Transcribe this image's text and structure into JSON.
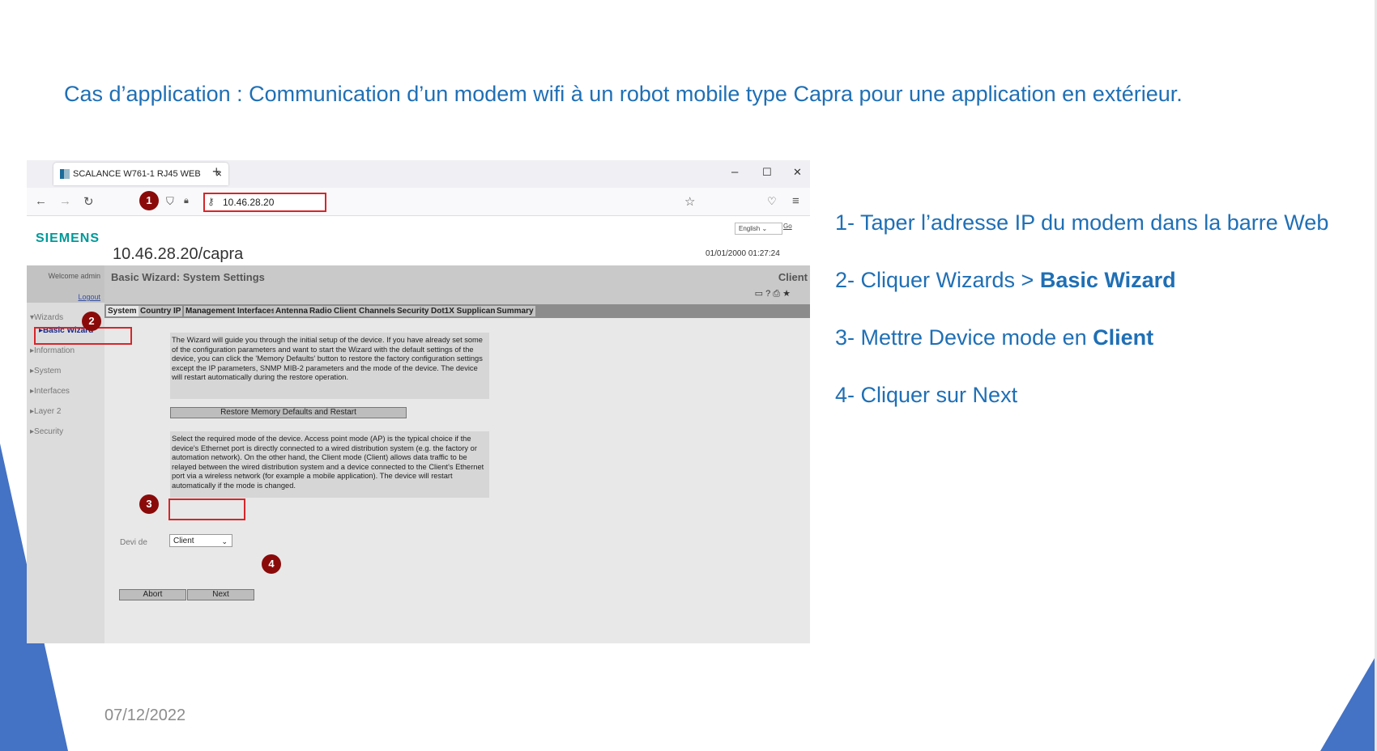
{
  "slide": {
    "title": "Cas d’application : Communication d’un modem wifi à un robot mobile type Capra pour une application en extérieur.",
    "steps": [
      {
        "text": "1- Taper l’adresse IP du modem dans la barre Web",
        "bold": ""
      },
      {
        "text": "2- Cliquer Wizards > ",
        "bold": "Basic Wizard"
      },
      {
        "text": "3- Mettre Device mode en ",
        "bold": "Client"
      },
      {
        "text": "4- Cliquer sur Next",
        "bold": ""
      }
    ],
    "date": "07/12/2022",
    "accent_color": "#1f6fb5"
  },
  "browser": {
    "tab_title": "SCALANCE W761-1 RJ45 WEB M",
    "tab_close": "×",
    "new_tab": "+",
    "window_controls": {
      "minimize": "–",
      "maximize": "☐",
      "close": "✕"
    },
    "nav_icons": {
      "back": "←",
      "forward": "→",
      "reload": "↻",
      "star": "☆",
      "pocket": "♡",
      "menu": "≡",
      "shield": "⛉",
      "lock": "🔒︎"
    },
    "url": "10.46.28.20",
    "key_icon": "⚷"
  },
  "markers": [
    "1",
    "2",
    "3",
    "4"
  ],
  "webui": {
    "logo": "SIEMENS",
    "language": "English",
    "go": "Go",
    "device_title": "10.46.28.20/capra",
    "datetime": "01/01/2000 01:27:24",
    "welcome": "Welcome admin",
    "logout": "Logout",
    "sidebar": [
      {
        "label": "▾Wizards"
      },
      {
        "label": "▸Basic Wizard"
      },
      {
        "label": "▸Information"
      },
      {
        "label": "▸System"
      },
      {
        "label": "▸Interfaces"
      },
      {
        "label": "▸Layer 2"
      },
      {
        "label": "▸Security"
      }
    ],
    "page_heading": "Basic Wizard: System Settings",
    "mode": "Client",
    "header_icons": "▭ ? ⎙ ★",
    "tabs": [
      "System",
      "Country",
      "IP",
      "Management Interfaces",
      "Antenna",
      "Radio",
      "Client",
      "Channels",
      "Security",
      "Dot1X Supplicant",
      "Summary"
    ],
    "intro_text": "The Wizard will guide you through the initial setup of the device. If you have already set some of the configuration parameters and want to start the Wizard with the default settings of the device, you can click the 'Memory Defaults' button to restore the factory configuration settings except the IP parameters, SNMP MIB-2 parameters and the mode of the device. The device will restart automatically during the restore operation.",
    "restore_button": "Restore Memory Defaults and Restart",
    "mode_text": "Select the required mode of the device. Access point mode (AP) is the typical choice if the device's Ethernet port is directly connected to a wired distribution system (e.g. the factory or automation network). On the other hand, the Client mode (Client) allows data traffic to be relayed between the wired distribution system and a device connected to the Client's Ethernet port via a wireless network (for example a mobile application). The device will restart automatically if the mode is changed.",
    "device_mode_label": "Devi      de",
    "device_mode_value": "Client",
    "abort_button": "Abort",
    "next_button": "Next"
  }
}
